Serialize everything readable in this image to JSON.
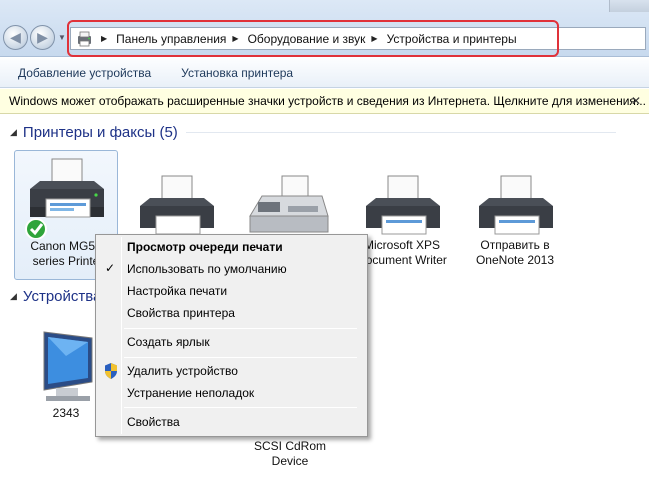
{
  "address_bar": {
    "crumbs": [
      "Панель управления",
      "Оборудование и звук",
      "Устройства и принтеры"
    ],
    "back_icon": "back-arrow-icon",
    "forward_icon": "forward-arrow-icon"
  },
  "toolbar": {
    "add_device": "Добавление устройства",
    "add_printer": "Установка принтера"
  },
  "infobar": {
    "text": "Windows может отображать расширенные значки устройств и сведения из Интернета.  Щелкните для изменения...",
    "close": "✕"
  },
  "printers_group": {
    "title": "Принтеры и факсы (5)",
    "devices": [
      {
        "label_line1": "Canon MG55",
        "label_line2": "series Printe"
      },
      {
        "label_line1": "",
        "label_line2": ""
      },
      {
        "label_line1": "",
        "label_line2": ""
      },
      {
        "label_line1": "Microsoft XPS",
        "label_line2": "Document Writer"
      },
      {
        "label_line1": "Отправить в",
        "label_line2": "OneNote 2013"
      }
    ]
  },
  "devices_group": {
    "title": "Устройства",
    "devices": [
      {
        "label_line1": "2343",
        "label_line2": ""
      },
      {
        "label_line1": "SCSI CdRom",
        "label_line2": "Device"
      }
    ]
  },
  "context_menu": {
    "view_queue": "Просмотр очереди печати",
    "set_default": "Использовать по умолчанию",
    "print_settings": "Настройка печати",
    "printer_props": "Свойства принтера",
    "create_shortcut": "Создать ярлык",
    "remove_device": "Удалить устройство",
    "troubleshoot": "Устранение неполадок",
    "properties": "Свойства",
    "check_mark": "✓"
  },
  "colors": {
    "highlight": "#e0323a",
    "group_title": "#1e3287",
    "infobar_bg": "#ffffe1"
  }
}
